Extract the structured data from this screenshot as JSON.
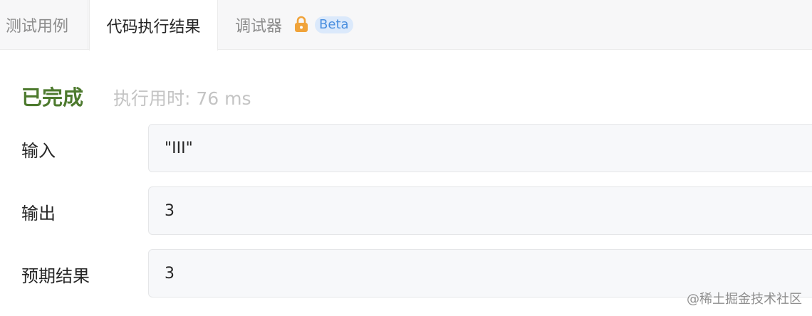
{
  "tabs": [
    {
      "label": "测试用例",
      "active": false
    },
    {
      "label": "代码执行结果",
      "active": true
    },
    {
      "label": "调试器",
      "active": false,
      "badge": "Beta",
      "icon": "lock-icon"
    }
  ],
  "status": {
    "state": "已完成",
    "time_label": "执行用时: 76 ms"
  },
  "rows": [
    {
      "label": "输入",
      "value": "\"III\""
    },
    {
      "label": "输出",
      "value": "3"
    },
    {
      "label": "预期结果",
      "value": "3"
    }
  ],
  "watermark": "@稀土掘金技术社区",
  "colors": {
    "success": "#4d7a2e",
    "lock": "#f0a33a",
    "badge_bg": "#dbe9fb",
    "badge_text": "#4a8fdf"
  }
}
